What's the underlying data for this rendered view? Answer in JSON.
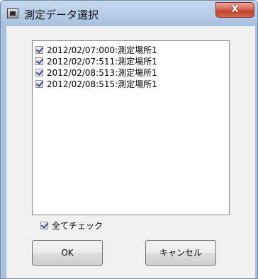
{
  "window": {
    "title": "測定データ選択",
    "close_label": "X"
  },
  "list": {
    "items": [
      {
        "label": "2012/02/07:000:測定場所1",
        "checked": true
      },
      {
        "label": "2012/02/07:511:測定場所1",
        "checked": true
      },
      {
        "label": "2012/02/08:513:測定場所1",
        "checked": true
      },
      {
        "label": "2012/02/08:515:測定場所1",
        "checked": true
      }
    ]
  },
  "check_all": {
    "label": "全てチェック",
    "checked": true
  },
  "buttons": {
    "ok_label": "OK",
    "cancel_label": "キャンセル"
  }
}
